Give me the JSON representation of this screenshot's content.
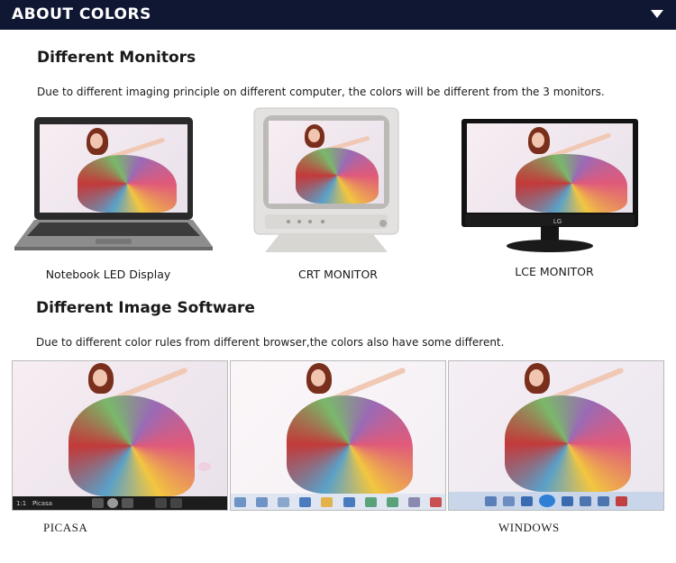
{
  "header": {
    "title": "ABOUT COLORS"
  },
  "monitors": {
    "title": "Different Monitors",
    "description": "Due to different imaging principle on different computer, the colors will be different from the 3 monitors.",
    "items": [
      {
        "caption": "Notebook LED Display"
      },
      {
        "caption": "CRT MONITOR"
      },
      {
        "caption": "LCE MONITOR",
        "brand": "LG"
      }
    ]
  },
  "software": {
    "title": "Different Image Software",
    "description": "Due to different color rules from different browser,the colors also have some different.",
    "items": [
      {
        "caption": "PICASA",
        "toolbar_text": "1:1   Picasa"
      },
      {
        "caption": ""
      },
      {
        "caption": "WINDOWS"
      }
    ]
  },
  "colors": {
    "header_bg": "#101733",
    "picasa_toolbar": "#1c1c1c",
    "photo_viewer_toolbar": "#dfe6f2",
    "windows_toolbar": "#c9d6ea"
  }
}
